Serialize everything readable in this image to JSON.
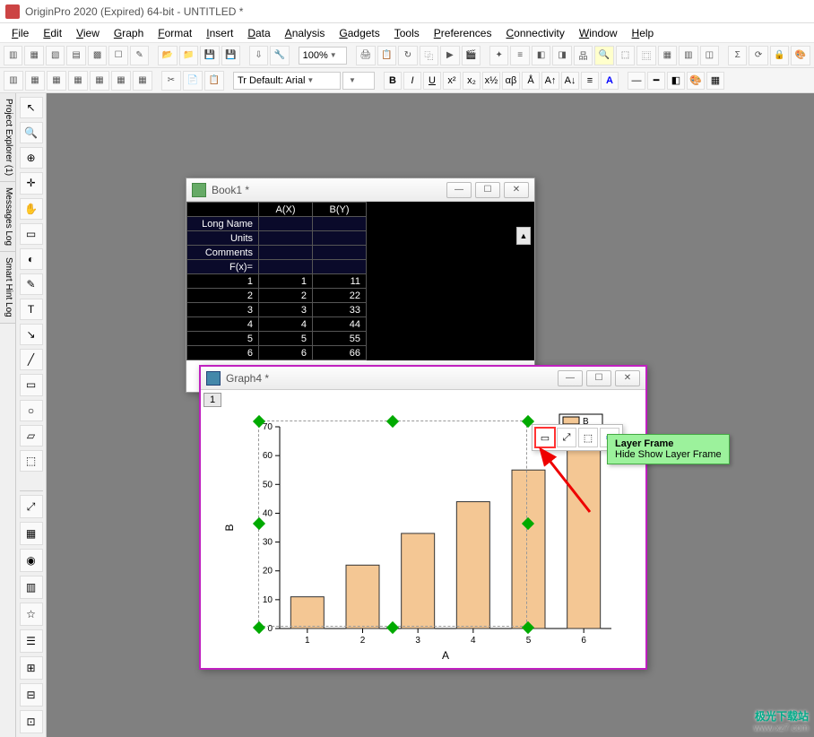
{
  "app_title": "OriginPro 2020 (Expired) 64-bit - UNTITLED *",
  "menu": [
    "File",
    "Edit",
    "View",
    "Graph",
    "Format",
    "Insert",
    "Data",
    "Analysis",
    "Gadgets",
    "Tools",
    "Preferences",
    "Connectivity",
    "Window",
    "Help"
  ],
  "zoom": "100%",
  "font_label": "Tr Default: Arial",
  "left_tabs": [
    "Project Explorer (1)",
    "Messages Log",
    "Smart Hint Log"
  ],
  "book": {
    "title": "Book1 *",
    "col_headers": [
      "A(X)",
      "B(Y)"
    ],
    "label_rows": [
      "Long Name",
      "Units",
      "Comments",
      "F(x)="
    ],
    "rows": [
      {
        "i": "1",
        "a": "1",
        "b": "11"
      },
      {
        "i": "2",
        "a": "2",
        "b": "22"
      },
      {
        "i": "3",
        "a": "3",
        "b": "33"
      },
      {
        "i": "4",
        "a": "4",
        "b": "44"
      },
      {
        "i": "5",
        "a": "5",
        "b": "55"
      },
      {
        "i": "6",
        "a": "6",
        "b": "66"
      }
    ]
  },
  "graph": {
    "title": "Graph4 *",
    "layer_tab": "1",
    "legend": "B"
  },
  "mini_toolbar": {
    "btn1": "layer-frame",
    "btn2": "rescale",
    "btn3": "fit-page",
    "btn4": "properties"
  },
  "tooltip": {
    "title": "Layer Frame",
    "body": "Hide Show Layer Frame"
  },
  "chart_data": {
    "type": "bar",
    "categories": [
      "1",
      "2",
      "3",
      "4",
      "5",
      "6"
    ],
    "values": [
      11,
      22,
      33,
      44,
      55,
      66
    ],
    "xlabel": "A",
    "ylabel": "B",
    "ylim": [
      0,
      70
    ],
    "yticks": [
      0,
      10,
      20,
      30,
      40,
      50,
      60,
      70
    ],
    "legend": "B"
  },
  "watermark": {
    "name": "极光下载站",
    "url": "www.xz7.com"
  }
}
